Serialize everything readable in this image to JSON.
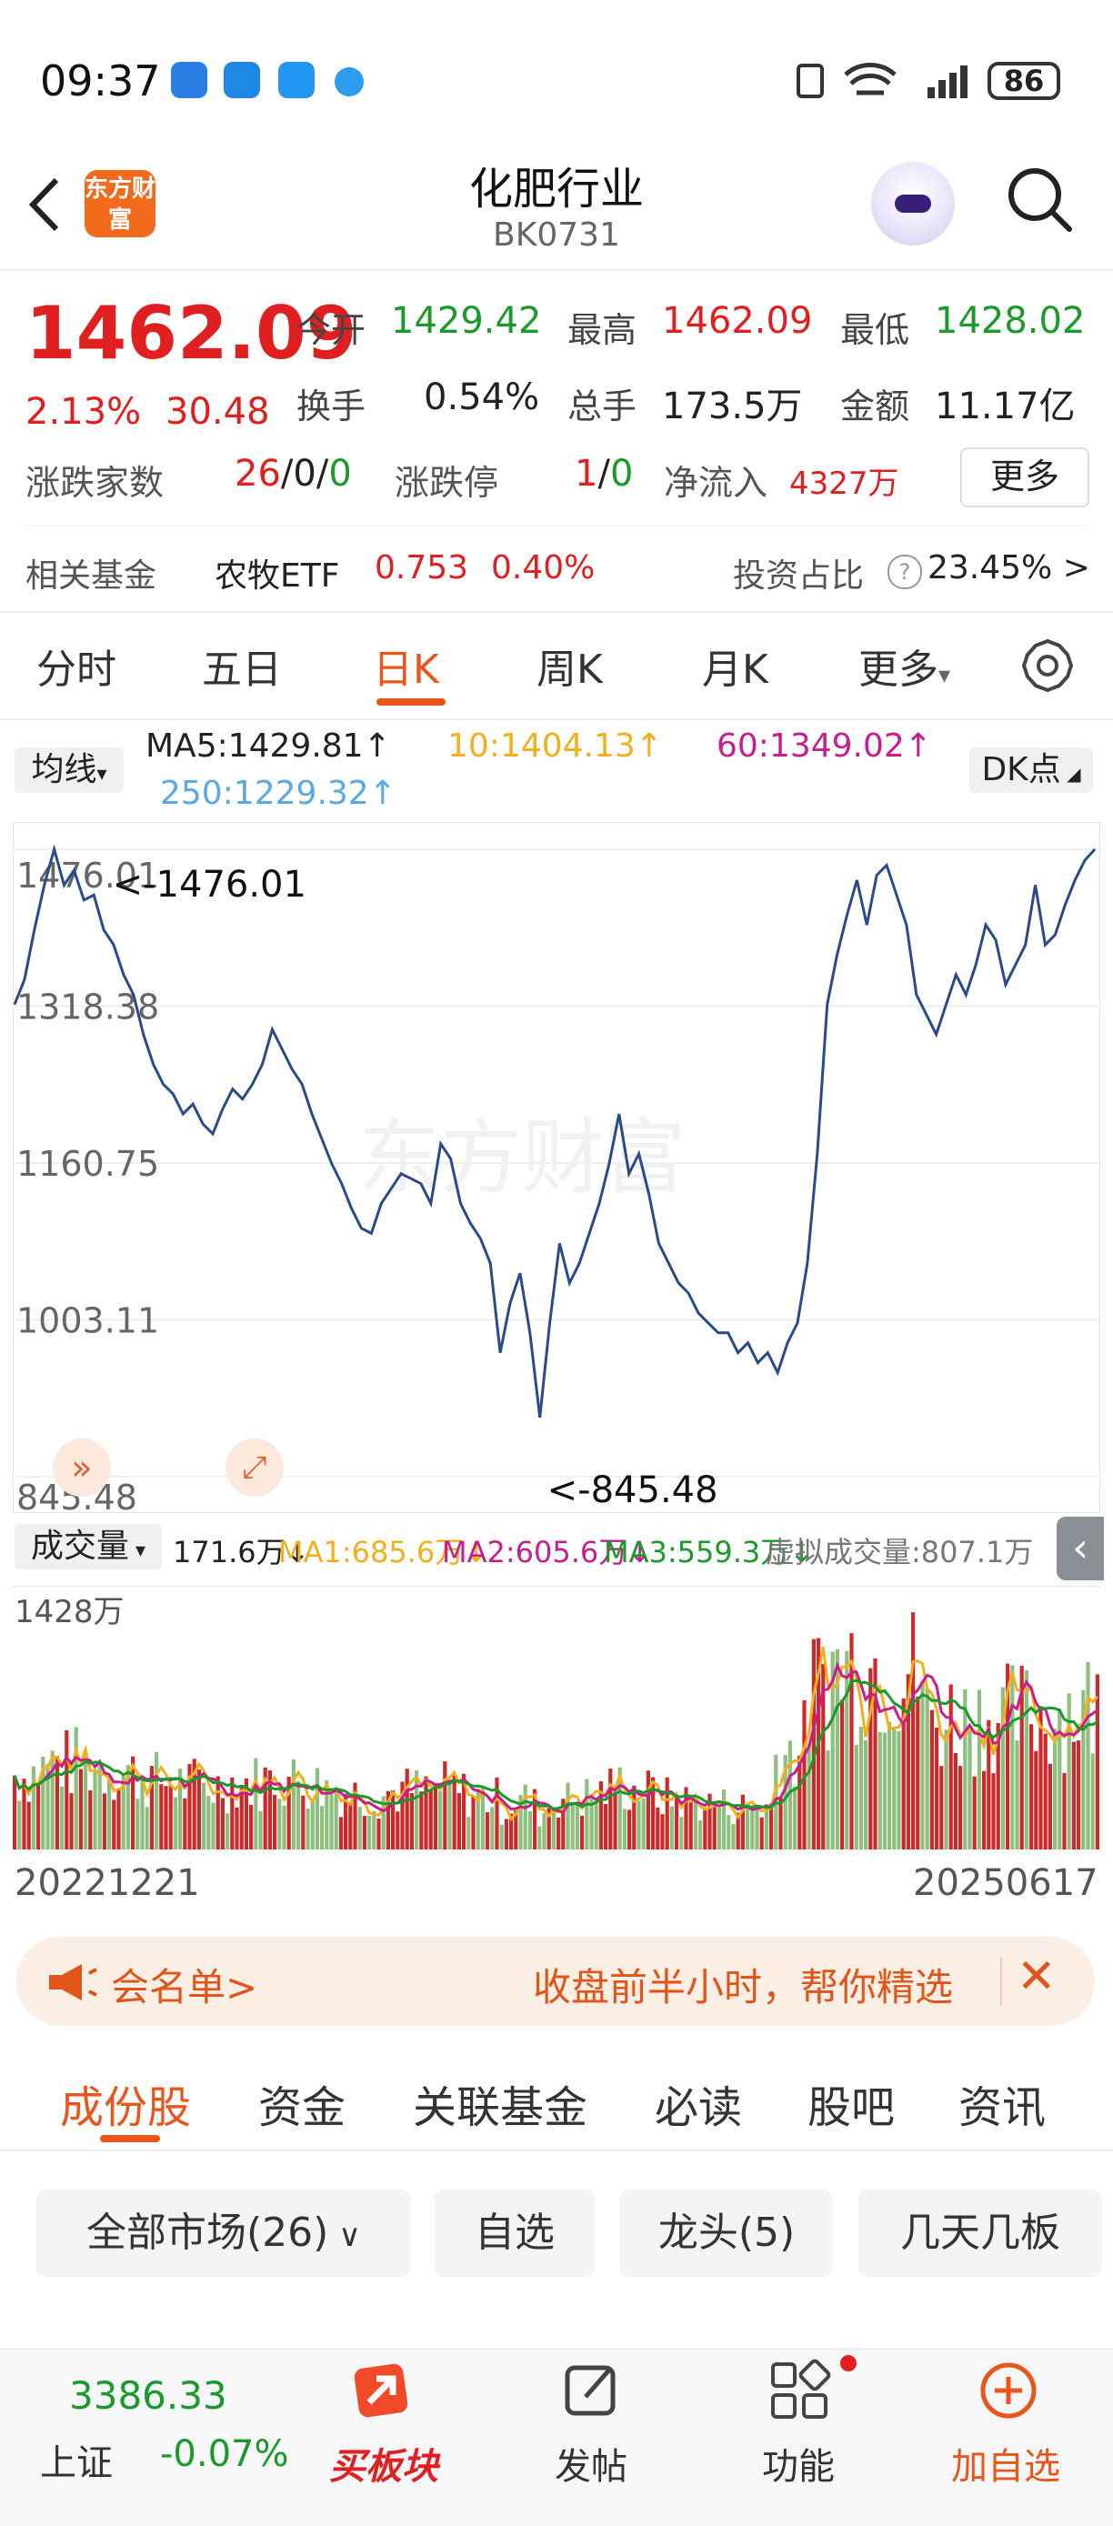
{
  "status_bar": {
    "time": "09:37",
    "battery": "86"
  },
  "header": {
    "title": "化肥行业",
    "code": "BK0731",
    "logo_text": "东方财富"
  },
  "quote": {
    "price": "1462.09",
    "change_pct": "2.13%",
    "change": "30.48",
    "open_label": "今开",
    "open": "1429.42",
    "high_label": "最高",
    "high": "1462.09",
    "low_label": "最低",
    "low": "1428.02",
    "turnover_label": "换手",
    "turnover": "0.54%",
    "volume_label": "总手",
    "volume": "173.5万",
    "amount_label": "金额",
    "amount": "11.17亿",
    "breadth_label": "涨跌家数",
    "breadth_up": "26",
    "breadth_sep1": "/",
    "breadth_flat": "0",
    "breadth_sep2": "/",
    "breadth_down": "0",
    "limit_label": "涨跌停",
    "limit_up": "1",
    "limit_sep": "/",
    "limit_down": "0",
    "netflow_label": "净流入",
    "netflow": "4327万",
    "more_label": "更多"
  },
  "fund": {
    "label": "相关基金",
    "name": "农牧ETF",
    "price": "0.753",
    "pct": "0.40%",
    "ratio_label": "投资占比",
    "ratio_value": "23.45% >"
  },
  "chart_tabs": [
    "分时",
    "五日",
    "日K",
    "周K",
    "月K",
    "更多"
  ],
  "ma": {
    "select": "均线",
    "ma5": "MA5:1429.81↑",
    "ma10": "10:1404.13↑",
    "ma60": "60:1349.02↑",
    "ma250": "250:1229.32↑",
    "dk": "DK点"
  },
  "chart_data": {
    "type": "line",
    "y_ticks": [
      "1476.01",
      "1318.38",
      "1160.75",
      "1003.11",
      "845.48"
    ],
    "ylim": [
      845.48,
      1476.01
    ],
    "high_marker": "<-1476.01",
    "low_marker": "<-845.48",
    "x_start": "20221221",
    "x_end": "20250617",
    "values": [
      1320,
      1345,
      1395,
      1440,
      1476,
      1440,
      1455,
      1425,
      1430,
      1395,
      1380,
      1350,
      1330,
      1290,
      1260,
      1240,
      1230,
      1210,
      1220,
      1200,
      1190,
      1215,
      1235,
      1225,
      1240,
      1260,
      1295,
      1275,
      1255,
      1240,
      1210,
      1185,
      1160,
      1140,
      1115,
      1095,
      1090,
      1120,
      1135,
      1150,
      1145,
      1140,
      1120,
      1180,
      1165,
      1120,
      1100,
      1085,
      1060,
      970,
      1020,
      1050,
      990,
      905,
      1000,
      1080,
      1040,
      1060,
      1090,
      1120,
      1160,
      1210,
      1150,
      1170,
      1130,
      1080,
      1060,
      1040,
      1030,
      1010,
      1000,
      990,
      990,
      970,
      980,
      960,
      970,
      950,
      980,
      1000,
      1060,
      1170,
      1320,
      1370,
      1410,
      1445,
      1400,
      1450,
      1460,
      1430,
      1400,
      1330,
      1310,
      1290,
      1320,
      1350,
      1330,
      1360,
      1400,
      1385,
      1340,
      1360,
      1380,
      1440,
      1380,
      1390,
      1420,
      1445,
      1465,
      1476
    ],
    "volume": {
      "label": "成交量",
      "value": "171.6万↓",
      "ma1": "MA1:685.6万↓",
      "ma2": "MA2:605.6万↓",
      "ma3": "MA3:559.3万↓",
      "virtual": "虚拟成交量:807.1万",
      "max_label": "1428万"
    }
  },
  "banner": {
    "left_text": "会名单>",
    "right_text": "收盘前半小时，帮你精选"
  },
  "bottom_tabs": [
    "成份股",
    "资金",
    "关联基金",
    "必读",
    "股吧",
    "资讯"
  ],
  "filters": [
    "全部市场(26)",
    "自选",
    "龙头(5)",
    "几天几板"
  ],
  "nav": {
    "index_value": "3386.33",
    "index_name": "上证",
    "index_pct": "-0.07%",
    "buy_label": "买板块",
    "post_label": "发帖",
    "func_label": "功能",
    "add_label": "加自选"
  },
  "colors": {
    "up": "#e02020",
    "down": "#1a9a2a",
    "accent": "#e8561a",
    "line": "#2a4a8a"
  }
}
